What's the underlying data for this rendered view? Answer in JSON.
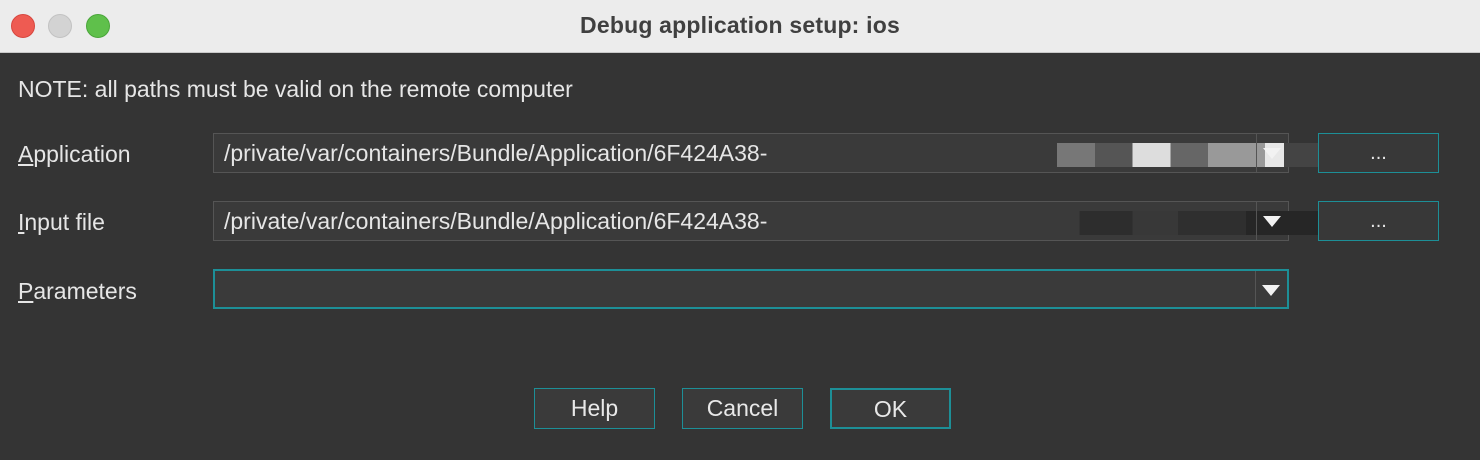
{
  "window": {
    "title": "Debug application setup: ios"
  },
  "note": "NOTE: all paths must be valid on the remote computer",
  "fields": {
    "application": {
      "label_mnemonic": "A",
      "label_rest": "pplication",
      "value": "/private/var/containers/Bundle/Application/6F424A38-",
      "browse_label": "..."
    },
    "input_file": {
      "label_mnemonic": "I",
      "label_rest": "nput file",
      "value": "/private/var/containers/Bundle/Application/6F424A38-",
      "browse_label": "..."
    },
    "parameters": {
      "label_mnemonic": "P",
      "label_rest": "arameters",
      "value": ""
    }
  },
  "buttons": {
    "help": "Help",
    "cancel": "Cancel",
    "ok": "OK"
  },
  "colors": {
    "accent": "#1d8f97",
    "background": "#343434",
    "titlebar": "#ececec"
  }
}
